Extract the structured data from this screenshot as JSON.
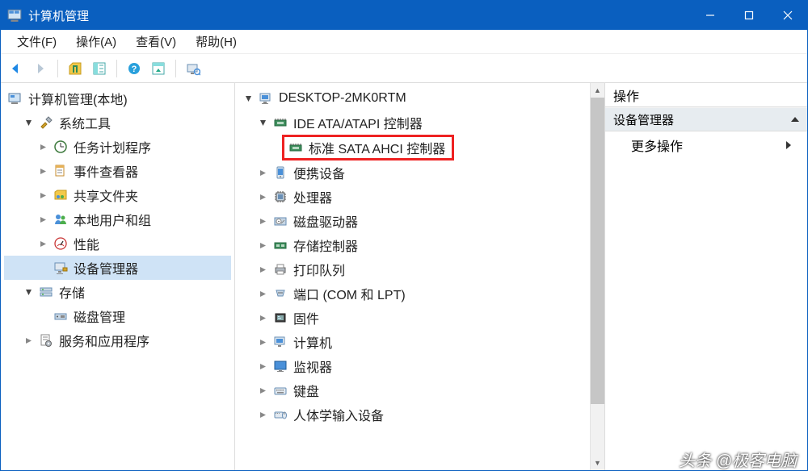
{
  "title": "计算机管理",
  "menus": {
    "file": "文件(F)",
    "action": "操作(A)",
    "view": "查看(V)",
    "help": "帮助(H)"
  },
  "left_tree": {
    "root": "计算机管理(本地)",
    "sys_tools": "系统工具",
    "task_scheduler": "任务计划程序",
    "event_viewer": "事件查看器",
    "shared_folders": "共享文件夹",
    "local_users": "本地用户和组",
    "performance": "性能",
    "device_manager": "设备管理器",
    "storage": "存储",
    "disk_mgmt": "磁盘管理",
    "services_apps": "服务和应用程序"
  },
  "mid_tree": {
    "computer": "DESKTOP-2MK0RTM",
    "ide": "IDE ATA/ATAPI 控制器",
    "sata_ahci": "标准 SATA AHCI 控制器",
    "portable": "便携设备",
    "processors": "处理器",
    "disk_drives": "磁盘驱动器",
    "storage_ctrl": "存储控制器",
    "print_queues": "打印队列",
    "ports": "端口 (COM 和 LPT)",
    "firmware": "固件",
    "computers": "计算机",
    "monitors": "监视器",
    "keyboards": "键盘",
    "hid": "人体学输入设备"
  },
  "right": {
    "header": "操作",
    "section": "设备管理器",
    "more": "更多操作"
  },
  "watermark": "头条 @极客电脑"
}
